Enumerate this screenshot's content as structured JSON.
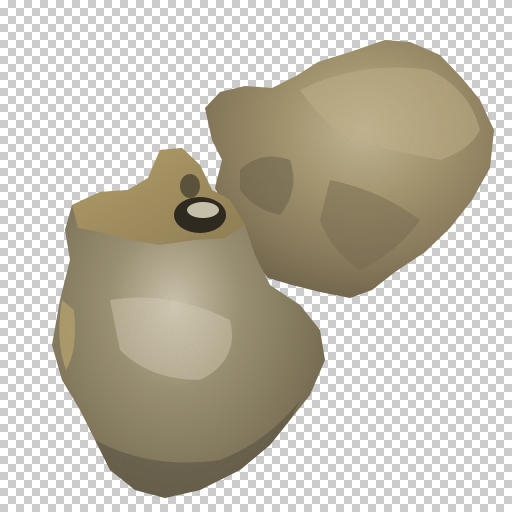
{
  "image": {
    "background": "transparency-checkerboard",
    "subject": "rock-pair",
    "colors": {
      "checker_light": "#ffffff",
      "checker_dark": "#cccccc",
      "stone_tan": "#a8925f",
      "stone_gray": "#8a8068",
      "stone_dark": "#3f3a2c",
      "highlight": "#d8cfb4"
    }
  }
}
